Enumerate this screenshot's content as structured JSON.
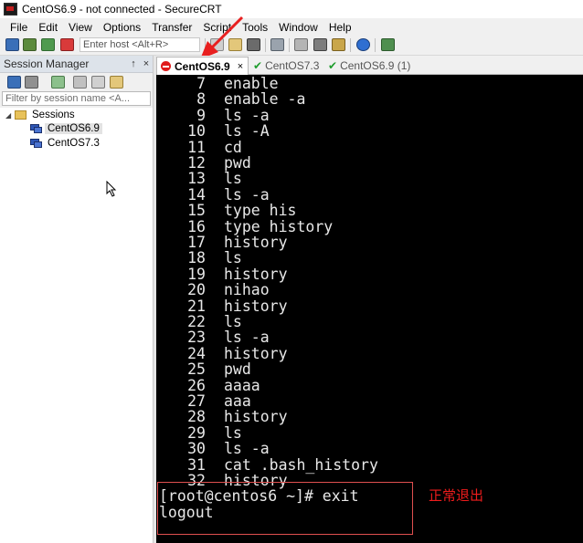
{
  "window": {
    "title": "CentOS6.9 - not connected - SecureCRT"
  },
  "menu": [
    "File",
    "Edit",
    "View",
    "Options",
    "Transfer",
    "Script",
    "Tools",
    "Window",
    "Help"
  ],
  "toolbar": {
    "host_placeholder": "Enter host <Alt+R>"
  },
  "session_manager": {
    "title": "Session Manager",
    "pin": "↑",
    "close": "×",
    "filter_placeholder": "Filter by session name <A...",
    "tree": {
      "expander": "◢",
      "root": "Sessions",
      "items": [
        "CentOS6.9",
        "CentOS7.3"
      ]
    }
  },
  "tabs": [
    {
      "label": "CentOS6.9",
      "status": "disconnected",
      "close": "×"
    },
    {
      "label": "CentOS7.3",
      "status": "connected"
    },
    {
      "label": "CentOS6.9 (1)",
      "status": "connected"
    }
  ],
  "terminal": {
    "history": [
      {
        "n": "7",
        "cmd": "enable"
      },
      {
        "n": "8",
        "cmd": "enable -a"
      },
      {
        "n": "9",
        "cmd": "ls -a"
      },
      {
        "n": "10",
        "cmd": "ls -A"
      },
      {
        "n": "11",
        "cmd": "cd"
      },
      {
        "n": "12",
        "cmd": "pwd"
      },
      {
        "n": "13",
        "cmd": "ls"
      },
      {
        "n": "14",
        "cmd": "ls -a"
      },
      {
        "n": "15",
        "cmd": "type his"
      },
      {
        "n": "16",
        "cmd": "type history"
      },
      {
        "n": "17",
        "cmd": "history"
      },
      {
        "n": "18",
        "cmd": "ls"
      },
      {
        "n": "19",
        "cmd": "history"
      },
      {
        "n": "20",
        "cmd": "nihao"
      },
      {
        "n": "21",
        "cmd": "history"
      },
      {
        "n": "22",
        "cmd": "ls"
      },
      {
        "n": "23",
        "cmd": "ls -a"
      },
      {
        "n": "24",
        "cmd": "history"
      },
      {
        "n": "25",
        "cmd": "pwd"
      },
      {
        "n": "26",
        "cmd": "aaaa"
      },
      {
        "n": "27",
        "cmd": "aaa"
      },
      {
        "n": "28",
        "cmd": "history"
      },
      {
        "n": "29",
        "cmd": "ls"
      },
      {
        "n": "30",
        "cmd": "ls -a"
      },
      {
        "n": "31",
        "cmd": "cat .bash_history"
      },
      {
        "n": "32",
        "cmd": "history"
      }
    ],
    "prompt_line": "[root@centos6 ~]# exit",
    "logout_line": "logout"
  },
  "annotation": {
    "text": "正常退出",
    "color": "#ee1c1c"
  },
  "colors": {
    "accent_red": "#e01b1b",
    "connected_green": "#1f9d2d",
    "terminal_bg": "#000000"
  }
}
